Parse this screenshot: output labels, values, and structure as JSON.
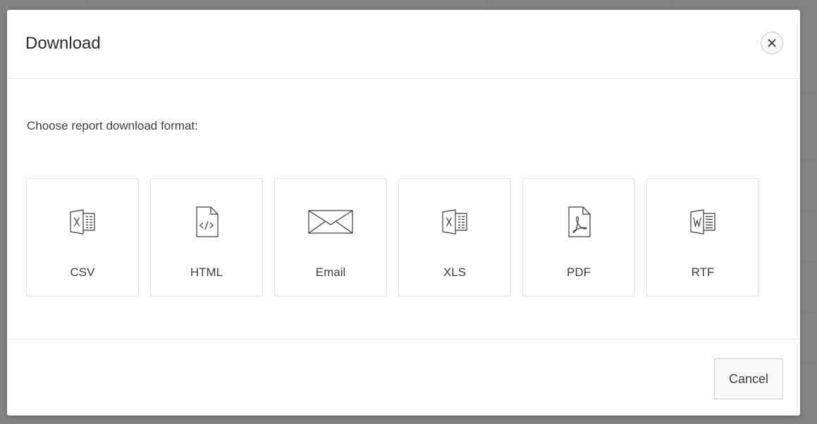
{
  "dialog": {
    "title": "Download",
    "prompt": "Choose report download format:",
    "formats": [
      {
        "label": "CSV",
        "icon": "csv-spreadsheet-icon"
      },
      {
        "label": "HTML",
        "icon": "html-code-file-icon"
      },
      {
        "label": "Email",
        "icon": "email-envelope-icon"
      },
      {
        "label": "XLS",
        "icon": "xls-spreadsheet-icon"
      },
      {
        "label": "PDF",
        "icon": "pdf-file-icon"
      },
      {
        "label": "RTF",
        "icon": "rtf-word-document-icon"
      }
    ],
    "close_icon": "close-icon",
    "cancel_label": "Cancel"
  },
  "colors": {
    "overlay": "#848484",
    "dialog_background": "#ffffff",
    "text": "#404040",
    "border": "#e3e3e3"
  }
}
